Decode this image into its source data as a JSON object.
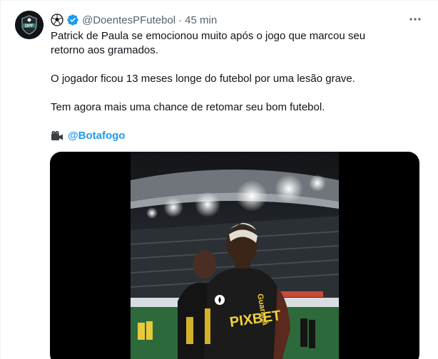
{
  "tweet": {
    "author": {
      "avatar_icon": "dpf-logo-icon",
      "name_icon": "soccer-ball-icon",
      "verified_icon": "verified-badge-icon",
      "handle": "@DoentesPFutebol",
      "separator": "·",
      "time": "45 min"
    },
    "more_icon": "more-options-icon",
    "paragraphs": [
      "Patrick de Paula se emocionou muito após o jogo que marcou seu retorno aos gramados.",
      "O jogador ficou 13 meses longe do futebol por uma lesão grave.",
      "Tem agora mais uma chance de retomar seu bom futebol."
    ],
    "credit": {
      "icon": "video-camera-icon",
      "mention": "@Botafogo"
    },
    "media": {
      "type": "video",
      "jersey_sponsor_text": "PIXBET",
      "accent_color": "#1d9bf0"
    }
  },
  "colors": {
    "text": "#0f1419",
    "secondary": "#536471",
    "link": "#1d9bf0",
    "verified": "#1d9bf0"
  }
}
